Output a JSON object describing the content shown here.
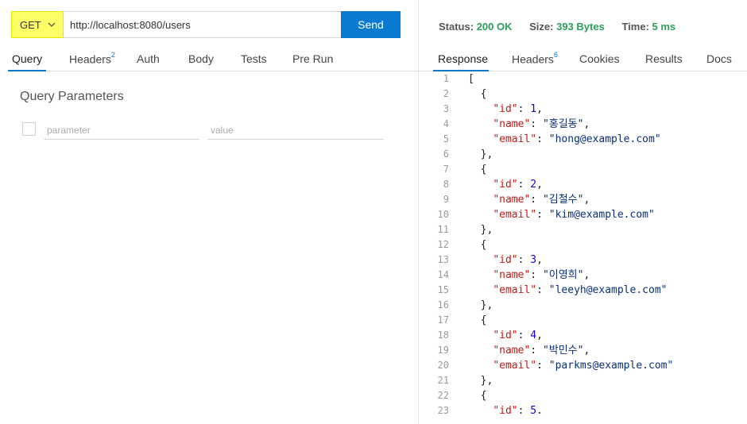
{
  "request": {
    "method": "GET",
    "url": "http://localhost:8080/users",
    "send_label": "Send"
  },
  "request_tabs": [
    {
      "label": "Query",
      "badge": ""
    },
    {
      "label": "Headers",
      "badge": "2"
    },
    {
      "label": "Auth",
      "badge": ""
    },
    {
      "label": "Body",
      "badge": ""
    },
    {
      "label": "Tests",
      "badge": ""
    },
    {
      "label": "Pre Run",
      "badge": ""
    }
  ],
  "query": {
    "title": "Query Parameters",
    "param_placeholder": "parameter",
    "value_placeholder": "value"
  },
  "response_status": {
    "status_label": "Status:",
    "status_value": "200 OK",
    "size_label": "Size:",
    "size_value": "393 Bytes",
    "time_label": "Time:",
    "time_value": "5 ms"
  },
  "response_tabs": [
    {
      "label": "Response",
      "badge": ""
    },
    {
      "label": "Headers",
      "badge": "6"
    },
    {
      "label": "Cookies",
      "badge": ""
    },
    {
      "label": "Results",
      "badge": ""
    },
    {
      "label": "Docs",
      "badge": ""
    }
  ],
  "code_lines": [
    {
      "n": "1",
      "indent": "",
      "parts": [
        [
          "pun",
          "["
        ]
      ]
    },
    {
      "n": "2",
      "indent": "  ",
      "parts": [
        [
          "pun",
          "{"
        ]
      ]
    },
    {
      "n": "3",
      "indent": "    ",
      "parts": [
        [
          "key",
          "\"id\""
        ],
        [
          "pun",
          ": "
        ],
        [
          "num",
          "1"
        ],
        [
          "pun",
          ","
        ]
      ]
    },
    {
      "n": "4",
      "indent": "    ",
      "parts": [
        [
          "key",
          "\"name\""
        ],
        [
          "pun",
          ": "
        ],
        [
          "str",
          "\"홍길동\""
        ],
        [
          "pun",
          ","
        ]
      ]
    },
    {
      "n": "5",
      "indent": "    ",
      "parts": [
        [
          "key",
          "\"email\""
        ],
        [
          "pun",
          ": "
        ],
        [
          "str",
          "\"hong@example.com\""
        ]
      ]
    },
    {
      "n": "6",
      "indent": "  ",
      "parts": [
        [
          "pun",
          "},"
        ]
      ]
    },
    {
      "n": "7",
      "indent": "  ",
      "parts": [
        [
          "pun",
          "{"
        ]
      ]
    },
    {
      "n": "8",
      "indent": "    ",
      "parts": [
        [
          "key",
          "\"id\""
        ],
        [
          "pun",
          ": "
        ],
        [
          "num",
          "2"
        ],
        [
          "pun",
          ","
        ]
      ]
    },
    {
      "n": "9",
      "indent": "    ",
      "parts": [
        [
          "key",
          "\"name\""
        ],
        [
          "pun",
          ": "
        ],
        [
          "str",
          "\"김철수\""
        ],
        [
          "pun",
          ","
        ]
      ]
    },
    {
      "n": "10",
      "indent": "    ",
      "parts": [
        [
          "key",
          "\"email\""
        ],
        [
          "pun",
          ": "
        ],
        [
          "str",
          "\"kim@example.com\""
        ]
      ]
    },
    {
      "n": "11",
      "indent": "  ",
      "parts": [
        [
          "pun",
          "},"
        ]
      ]
    },
    {
      "n": "12",
      "indent": "  ",
      "parts": [
        [
          "pun",
          "{"
        ]
      ]
    },
    {
      "n": "13",
      "indent": "    ",
      "parts": [
        [
          "key",
          "\"id\""
        ],
        [
          "pun",
          ": "
        ],
        [
          "num",
          "3"
        ],
        [
          "pun",
          ","
        ]
      ]
    },
    {
      "n": "14",
      "indent": "    ",
      "parts": [
        [
          "key",
          "\"name\""
        ],
        [
          "pun",
          ": "
        ],
        [
          "str",
          "\"이영희\""
        ],
        [
          "pun",
          ","
        ]
      ]
    },
    {
      "n": "15",
      "indent": "    ",
      "parts": [
        [
          "key",
          "\"email\""
        ],
        [
          "pun",
          ": "
        ],
        [
          "str",
          "\"leeyh@example.com\""
        ]
      ]
    },
    {
      "n": "16",
      "indent": "  ",
      "parts": [
        [
          "pun",
          "},"
        ]
      ]
    },
    {
      "n": "17",
      "indent": "  ",
      "parts": [
        [
          "pun",
          "{"
        ]
      ]
    },
    {
      "n": "18",
      "indent": "    ",
      "parts": [
        [
          "key",
          "\"id\""
        ],
        [
          "pun",
          ": "
        ],
        [
          "num",
          "4"
        ],
        [
          "pun",
          ","
        ]
      ]
    },
    {
      "n": "19",
      "indent": "    ",
      "parts": [
        [
          "key",
          "\"name\""
        ],
        [
          "pun",
          ": "
        ],
        [
          "str",
          "\"박민수\""
        ],
        [
          "pun",
          ","
        ]
      ]
    },
    {
      "n": "20",
      "indent": "    ",
      "parts": [
        [
          "key",
          "\"email\""
        ],
        [
          "pun",
          ": "
        ],
        [
          "str",
          "\"parkms@example.com\""
        ]
      ]
    },
    {
      "n": "21",
      "indent": "  ",
      "parts": [
        [
          "pun",
          "},"
        ]
      ]
    },
    {
      "n": "22",
      "indent": "  ",
      "parts": [
        [
          "pun",
          "{"
        ]
      ]
    },
    {
      "n": "23",
      "indent": "    ",
      "parts": [
        [
          "key",
          "\"id\""
        ],
        [
          "pun",
          ": "
        ],
        [
          "num",
          "5"
        ],
        [
          "pun",
          "."
        ]
      ]
    }
  ]
}
